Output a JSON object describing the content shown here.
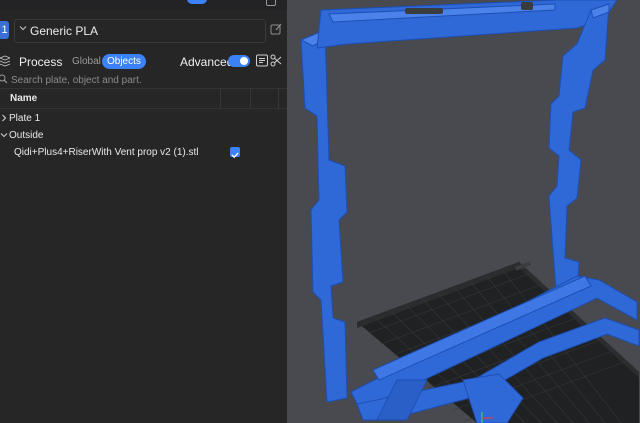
{
  "filament": {
    "index": "1",
    "selected": "Generic PLA"
  },
  "process": {
    "title": "Process",
    "tab_global": "Global",
    "tab_objects": "Objects",
    "advanced_label": "Advanced",
    "advanced_on": true
  },
  "search": {
    "placeholder": "Search plate, object and part."
  },
  "table": {
    "column_name": "Name"
  },
  "tree": {
    "plate": "Plate 1",
    "group": "Outside",
    "object": "Qidi+Plus4+RiserWith Vent prop v2 (1).stl",
    "object_checked": true
  },
  "colors": {
    "accent": "#3b82f6",
    "model": "#2f69d8",
    "panel_bg": "#262627",
    "viewport_bg": "#484a4f"
  }
}
